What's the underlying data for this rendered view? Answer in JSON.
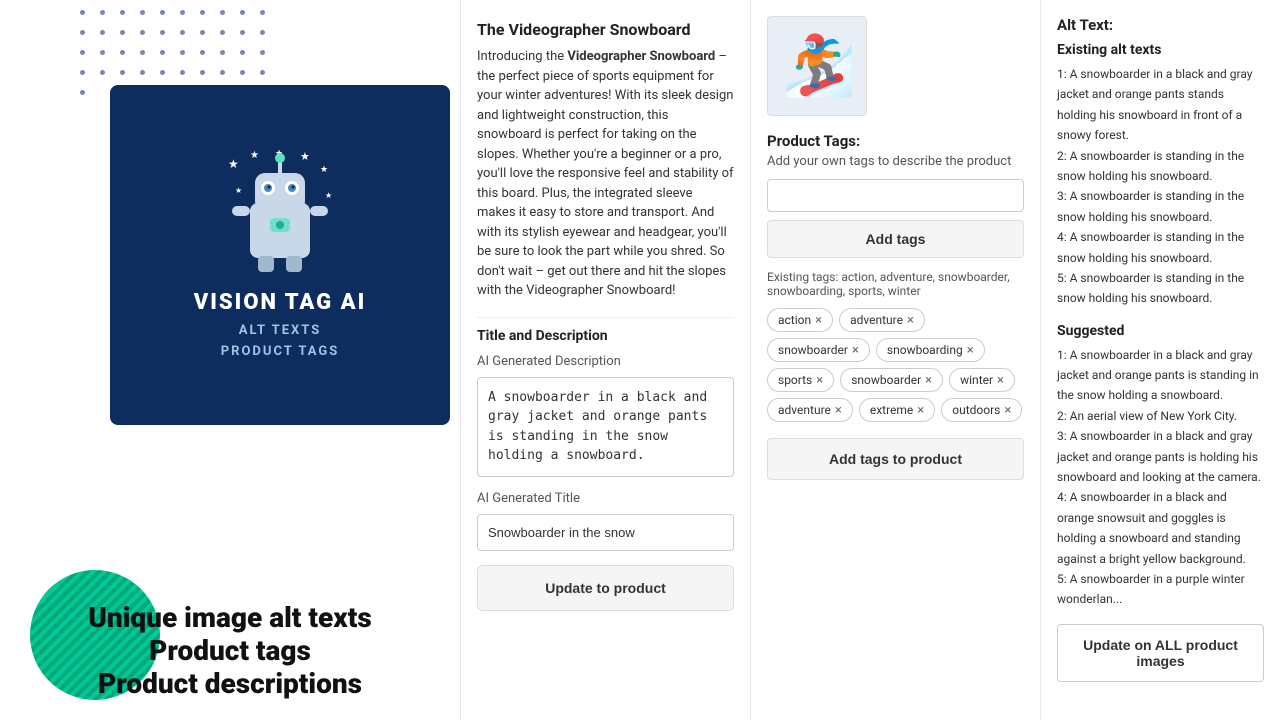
{
  "left": {
    "brand": "VISION TAG AI",
    "tagline_line1": "ALT TEXTS",
    "tagline_line2": "PRODUCT TAGS",
    "bottom_line1": "Unique image alt texts",
    "bottom_line2": "Product tags",
    "bottom_line3": "Product descriptions"
  },
  "middle": {
    "product_title": "The Videographer Snowboard",
    "product_description_pre": "Introducing the ",
    "product_description_bold": "Videographer Snowboard",
    "product_description_post": " – the perfect piece of sports equipment for your winter adventures! With its sleek design and lightweight construction, this snowboard is perfect for taking on the slopes. Whether you're a beginner or a pro, you'll love the responsive feel and stability of this board. Plus, the integrated sleeve makes it easy to store and transport. And with its stylish eyewear and headgear, you'll be sure to look the part while you shred. So don't wait – get out there and hit the slopes with the Videographer Snowboard!",
    "title_section": "Title and Description",
    "ai_desc_label": "AI Generated Description",
    "ai_desc_value": "A snowboarder in a black and gray jacket and orange pants is standing in the snow holding a snowboard.",
    "ai_title_label": "AI Generated Title",
    "ai_title_value": "Snowboarder in the snow",
    "update_btn": "Update to product"
  },
  "tags": {
    "title": "Product Tags:",
    "subtitle": "Add your own tags to describe the product",
    "input_placeholder": "",
    "add_btn": "Add tags",
    "existing_label": "Existing tags: action, adventure, snowboarder, snowboarding, sports, winter",
    "tags": [
      {
        "label": "action"
      },
      {
        "label": "adventure"
      },
      {
        "label": "snowboarder"
      },
      {
        "label": "snowboarding"
      },
      {
        "label": "sports"
      },
      {
        "label": "snowboarder"
      },
      {
        "label": "winter"
      },
      {
        "label": "adventure"
      },
      {
        "label": "extreme"
      },
      {
        "label": "outdoors"
      }
    ],
    "add_to_product_btn": "Add tags to product"
  },
  "alt": {
    "title": "Alt Text:",
    "existing_title": "Existing alt texts",
    "existing": [
      "1: A snowboarder in a black and gray jacket and orange pants stands holding his snowboard in front of a snowy forest.",
      "2: A snowboarder is standing in the snow holding his snowboard.",
      "3: A snowboarder is standing in the snow holding his snowboard.",
      "4: A snowboarder is standing in the snow holding his snowboard.",
      "5: A snowboarder is standing in the snow holding his snowboard."
    ],
    "suggested_title": "Suggested",
    "suggested": [
      "1: A snowboarder in a black and gray jacket and orange pants is standing in the snow holding a snowboard.",
      "2: An aerial view of New York City.",
      "3: A snowboarder in a black and gray jacket and orange pants is holding his snowboard and looking at the camera.",
      "4: A snowboarder in a black and orange snowsuit and goggles is holding a snowboard and standing against a bright yellow background.",
      "5: A snowboarder in a purple winter wonderlan..."
    ],
    "update_btn": "Update on ALL product images"
  },
  "icons": {
    "close": "×",
    "snowboarder": "🏂"
  }
}
